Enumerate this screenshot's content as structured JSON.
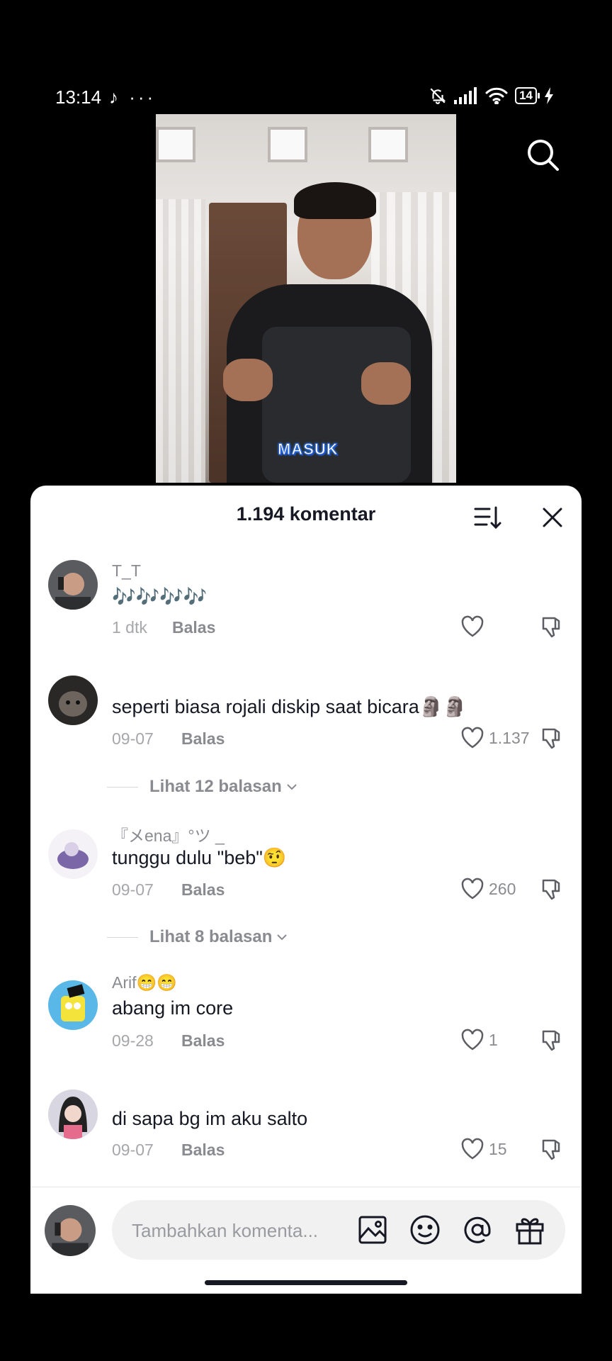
{
  "status_bar": {
    "time": "13:14",
    "left_icons": "♪ ···",
    "battery": "14"
  },
  "video": {
    "caption": "MASUK"
  },
  "comments_panel": {
    "title": "1.194 komentar",
    "comments": [
      {
        "user": "T_T",
        "text": "🎶🎶🎶🎶",
        "time": "1 dtk",
        "reply": "Balas",
        "likes": ""
      },
      {
        "user": "",
        "text": "seperti biasa rojali diskip saat bicara🗿🗿",
        "time": "09-07",
        "reply": "Balas",
        "likes": "1.137",
        "view_replies": "Lihat 12 balasan"
      },
      {
        "user": "『メena』°ツ _",
        "text": "tunggu dulu \"beb\"🤨",
        "time": "09-07",
        "reply": "Balas",
        "likes": "260",
        "view_replies": "Lihat 8 balasan"
      },
      {
        "user": "Arif😁😁",
        "text": "abang im core",
        "time": "09-28",
        "reply": "Balas",
        "likes": "1"
      },
      {
        "user": "",
        "text": "di sapa bg im aku salto",
        "time": "09-07",
        "reply": "Balas",
        "likes": "15"
      }
    ],
    "input_placeholder": "Tambahkan komenta..."
  },
  "icons": {
    "search": "search-icon",
    "sort": "sort-icon",
    "close": "close-icon",
    "heart": "heart-icon",
    "dislike": "thumbs-down-icon",
    "image": "image-icon",
    "emoji": "emoji-icon",
    "mention": "at-icon",
    "gift": "gift-icon"
  },
  "colors": {
    "background": "#000000",
    "sheet": "#ffffff",
    "text_primary": "#161823",
    "text_secondary": "#8a8b91"
  }
}
